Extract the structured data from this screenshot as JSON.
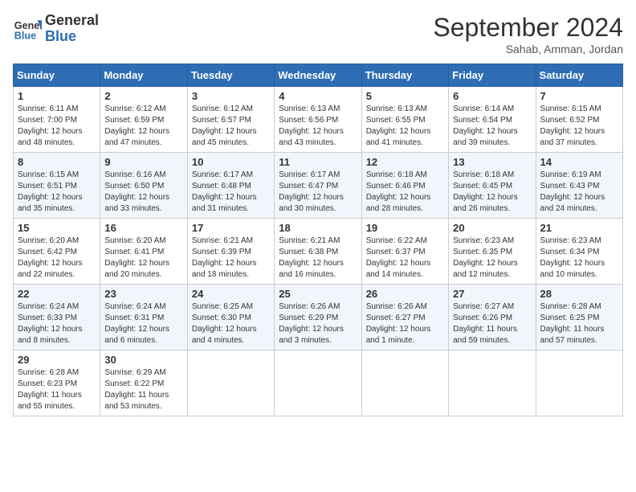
{
  "header": {
    "logo_line1": "General",
    "logo_line2": "Blue",
    "month": "September 2024",
    "location": "Sahab, Amman, Jordan"
  },
  "weekdays": [
    "Sunday",
    "Monday",
    "Tuesday",
    "Wednesday",
    "Thursday",
    "Friday",
    "Saturday"
  ],
  "weeks": [
    [
      {
        "day": "1",
        "sunrise": "Sunrise: 6:11 AM",
        "sunset": "Sunset: 7:00 PM",
        "daylight": "Daylight: 12 hours and 48 minutes."
      },
      {
        "day": "2",
        "sunrise": "Sunrise: 6:12 AM",
        "sunset": "Sunset: 6:59 PM",
        "daylight": "Daylight: 12 hours and 47 minutes."
      },
      {
        "day": "3",
        "sunrise": "Sunrise: 6:12 AM",
        "sunset": "Sunset: 6:57 PM",
        "daylight": "Daylight: 12 hours and 45 minutes."
      },
      {
        "day": "4",
        "sunrise": "Sunrise: 6:13 AM",
        "sunset": "Sunset: 6:56 PM",
        "daylight": "Daylight: 12 hours and 43 minutes."
      },
      {
        "day": "5",
        "sunrise": "Sunrise: 6:13 AM",
        "sunset": "Sunset: 6:55 PM",
        "daylight": "Daylight: 12 hours and 41 minutes."
      },
      {
        "day": "6",
        "sunrise": "Sunrise: 6:14 AM",
        "sunset": "Sunset: 6:54 PM",
        "daylight": "Daylight: 12 hours and 39 minutes."
      },
      {
        "day": "7",
        "sunrise": "Sunrise: 6:15 AM",
        "sunset": "Sunset: 6:52 PM",
        "daylight": "Daylight: 12 hours and 37 minutes."
      }
    ],
    [
      {
        "day": "8",
        "sunrise": "Sunrise: 6:15 AM",
        "sunset": "Sunset: 6:51 PM",
        "daylight": "Daylight: 12 hours and 35 minutes."
      },
      {
        "day": "9",
        "sunrise": "Sunrise: 6:16 AM",
        "sunset": "Sunset: 6:50 PM",
        "daylight": "Daylight: 12 hours and 33 minutes."
      },
      {
        "day": "10",
        "sunrise": "Sunrise: 6:17 AM",
        "sunset": "Sunset: 6:48 PM",
        "daylight": "Daylight: 12 hours and 31 minutes."
      },
      {
        "day": "11",
        "sunrise": "Sunrise: 6:17 AM",
        "sunset": "Sunset: 6:47 PM",
        "daylight": "Daylight: 12 hours and 30 minutes."
      },
      {
        "day": "12",
        "sunrise": "Sunrise: 6:18 AM",
        "sunset": "Sunset: 6:46 PM",
        "daylight": "Daylight: 12 hours and 28 minutes."
      },
      {
        "day": "13",
        "sunrise": "Sunrise: 6:18 AM",
        "sunset": "Sunset: 6:45 PM",
        "daylight": "Daylight: 12 hours and 26 minutes."
      },
      {
        "day": "14",
        "sunrise": "Sunrise: 6:19 AM",
        "sunset": "Sunset: 6:43 PM",
        "daylight": "Daylight: 12 hours and 24 minutes."
      }
    ],
    [
      {
        "day": "15",
        "sunrise": "Sunrise: 6:20 AM",
        "sunset": "Sunset: 6:42 PM",
        "daylight": "Daylight: 12 hours and 22 minutes."
      },
      {
        "day": "16",
        "sunrise": "Sunrise: 6:20 AM",
        "sunset": "Sunset: 6:41 PM",
        "daylight": "Daylight: 12 hours and 20 minutes."
      },
      {
        "day": "17",
        "sunrise": "Sunrise: 6:21 AM",
        "sunset": "Sunset: 6:39 PM",
        "daylight": "Daylight: 12 hours and 18 minutes."
      },
      {
        "day": "18",
        "sunrise": "Sunrise: 6:21 AM",
        "sunset": "Sunset: 6:38 PM",
        "daylight": "Daylight: 12 hours and 16 minutes."
      },
      {
        "day": "19",
        "sunrise": "Sunrise: 6:22 AM",
        "sunset": "Sunset: 6:37 PM",
        "daylight": "Daylight: 12 hours and 14 minutes."
      },
      {
        "day": "20",
        "sunrise": "Sunrise: 6:23 AM",
        "sunset": "Sunset: 6:35 PM",
        "daylight": "Daylight: 12 hours and 12 minutes."
      },
      {
        "day": "21",
        "sunrise": "Sunrise: 6:23 AM",
        "sunset": "Sunset: 6:34 PM",
        "daylight": "Daylight: 12 hours and 10 minutes."
      }
    ],
    [
      {
        "day": "22",
        "sunrise": "Sunrise: 6:24 AM",
        "sunset": "Sunset: 6:33 PM",
        "daylight": "Daylight: 12 hours and 8 minutes."
      },
      {
        "day": "23",
        "sunrise": "Sunrise: 6:24 AM",
        "sunset": "Sunset: 6:31 PM",
        "daylight": "Daylight: 12 hours and 6 minutes."
      },
      {
        "day": "24",
        "sunrise": "Sunrise: 6:25 AM",
        "sunset": "Sunset: 6:30 PM",
        "daylight": "Daylight: 12 hours and 4 minutes."
      },
      {
        "day": "25",
        "sunrise": "Sunrise: 6:26 AM",
        "sunset": "Sunset: 6:29 PM",
        "daylight": "Daylight: 12 hours and 3 minutes."
      },
      {
        "day": "26",
        "sunrise": "Sunrise: 6:26 AM",
        "sunset": "Sunset: 6:27 PM",
        "daylight": "Daylight: 12 hours and 1 minute."
      },
      {
        "day": "27",
        "sunrise": "Sunrise: 6:27 AM",
        "sunset": "Sunset: 6:26 PM",
        "daylight": "Daylight: 11 hours and 59 minutes."
      },
      {
        "day": "28",
        "sunrise": "Sunrise: 6:28 AM",
        "sunset": "Sunset: 6:25 PM",
        "daylight": "Daylight: 11 hours and 57 minutes."
      }
    ],
    [
      {
        "day": "29",
        "sunrise": "Sunrise: 6:28 AM",
        "sunset": "Sunset: 6:23 PM",
        "daylight": "Daylight: 11 hours and 55 minutes."
      },
      {
        "day": "30",
        "sunrise": "Sunrise: 6:29 AM",
        "sunset": "Sunset: 6:22 PM",
        "daylight": "Daylight: 11 hours and 53 minutes."
      },
      null,
      null,
      null,
      null,
      null
    ]
  ]
}
